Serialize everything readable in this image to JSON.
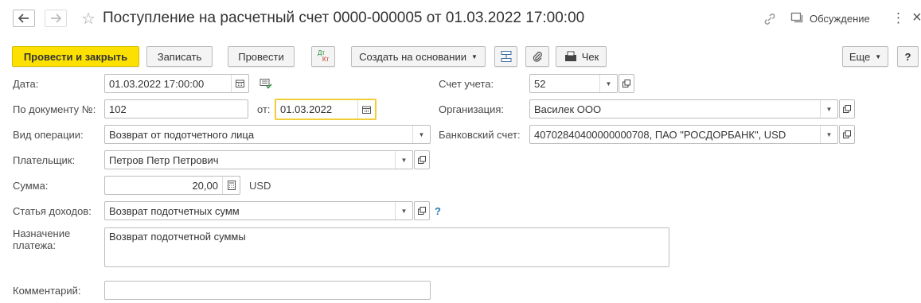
{
  "window": {
    "title": "Поступление на расчетный счет 0000-000005 от 01.03.2022 17:00:00",
    "discussion_label": "Обсуждение",
    "more_dots": "⋮",
    "close": "×"
  },
  "toolbar": {
    "post_close": "Провести и закрыть",
    "save": "Записать",
    "post": "Провести",
    "dt_top": "Дт",
    "dt_bottom": "Кт",
    "create_based": "Создать на основании",
    "receipt": "Чек",
    "more": "Еще",
    "help": "?"
  },
  "form": {
    "date": {
      "label": "Дата:",
      "value": "01.03.2022 17:00:00"
    },
    "doc_number": {
      "label": "По документу №:",
      "value": "102",
      "from_label": "от:",
      "from_value": "01.03.2022"
    },
    "operation": {
      "label": "Вид операции:",
      "value": "Возврат от подотчетного лица"
    },
    "payer": {
      "label": "Плательщик:",
      "value": "Петров Петр Петрович"
    },
    "amount": {
      "label": "Сумма:",
      "value": "20,00",
      "currency": "USD"
    },
    "income_item": {
      "label": "Статья доходов:",
      "value": "Возврат подотчетных сумм",
      "help": "?"
    },
    "purpose": {
      "label_line1": "Назначение",
      "label_line2": "платежа:",
      "value": "Возврат подотчетной суммы"
    },
    "comment": {
      "label": "Комментарий:",
      "value": ""
    },
    "account": {
      "label": "Счет учета:",
      "value": "52"
    },
    "organization": {
      "label": "Организация:",
      "value": "Василек ООО"
    },
    "bank_account": {
      "label": "Банковский счет:",
      "value": "40702840400000000708, ПАО \"РОСДОРБАНК\", USD"
    }
  },
  "colors": {
    "primary_button": "#fbe000",
    "focus_border": "#f2cd3a",
    "help_link": "#2a7ab0"
  }
}
